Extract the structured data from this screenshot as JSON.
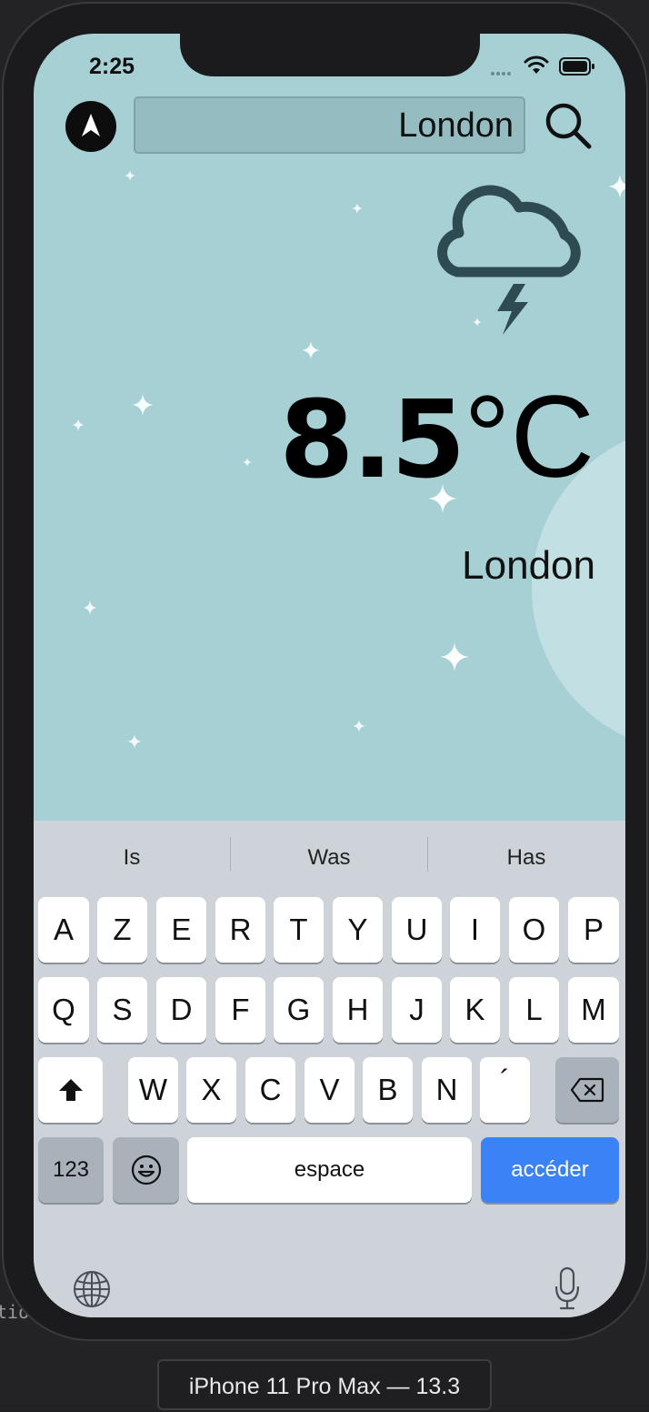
{
  "status_bar": {
    "time": "2:25"
  },
  "search": {
    "value": "London",
    "placeholder": ""
  },
  "weather": {
    "condition_icon": "cloud-lightning-icon",
    "temperature": "8.5",
    "unit": "°C",
    "city": "London"
  },
  "keyboard": {
    "suggestions": [
      "Is",
      "Was",
      "Has"
    ],
    "row1": [
      "A",
      "Z",
      "E",
      "R",
      "T",
      "Y",
      "U",
      "I",
      "O",
      "P"
    ],
    "row2": [
      "Q",
      "S",
      "D",
      "F",
      "G",
      "H",
      "J",
      "K",
      "L",
      "M"
    ],
    "row3": [
      "W",
      "X",
      "C",
      "V",
      "B",
      "N",
      "´"
    ],
    "numbers_key": "123",
    "space_key": "espace",
    "go_key": "accéder"
  },
  "device_label": "iPhone 11 Pro Max — 13.3",
  "side_text": "tion",
  "colors": {
    "sky": "#a6d0d4",
    "icon": "#2f4b52",
    "go_key": "#3b82f6",
    "keyboard_bg": "#cdd3d8"
  }
}
